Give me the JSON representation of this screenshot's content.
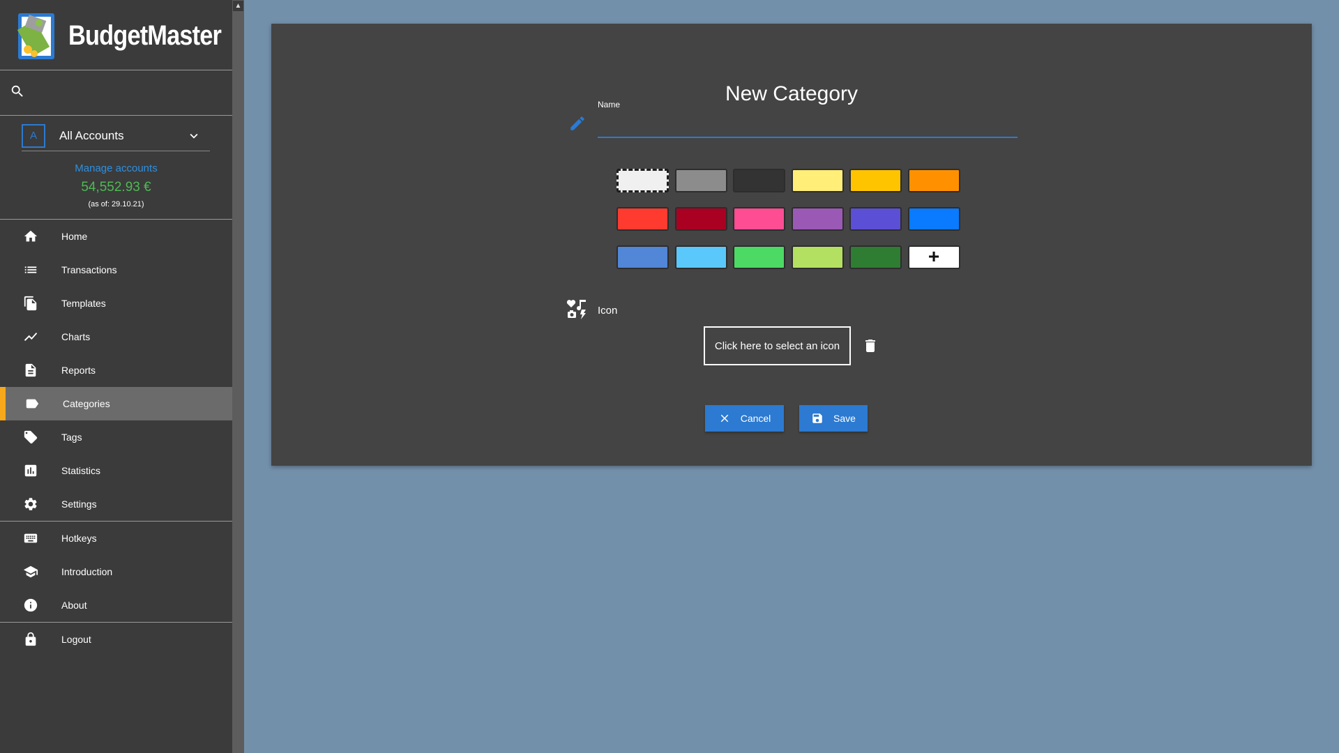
{
  "app": {
    "title": "BudgetMaster"
  },
  "account": {
    "avatar_letter": "A",
    "selected": "All Accounts",
    "manage_label": "Manage accounts",
    "balance": "54,552.93 €",
    "as_of": "(as of: 29.10.21)"
  },
  "nav": {
    "main": [
      {
        "label": "Home",
        "icon": "home-icon"
      },
      {
        "label": "Transactions",
        "icon": "list-icon"
      },
      {
        "label": "Templates",
        "icon": "copy-icon"
      },
      {
        "label": "Charts",
        "icon": "line-chart-icon"
      },
      {
        "label": "Reports",
        "icon": "document-icon"
      },
      {
        "label": "Categories",
        "icon": "label-icon",
        "active": true
      },
      {
        "label": "Tags",
        "icon": "tag-icon"
      },
      {
        "label": "Statistics",
        "icon": "bar-chart-icon"
      },
      {
        "label": "Settings",
        "icon": "gear-icon"
      }
    ],
    "secondary": [
      {
        "label": "Hotkeys",
        "icon": "keyboard-icon"
      },
      {
        "label": "Introduction",
        "icon": "graduation-cap-icon"
      },
      {
        "label": "About",
        "icon": "info-icon"
      }
    ],
    "logout": {
      "label": "Logout",
      "icon": "lock-icon"
    }
  },
  "form": {
    "title": "New Category",
    "name_label": "Name",
    "name_value": "",
    "icon_label": "Icon",
    "icon_select_label": "Click here to select an icon",
    "cancel_label": "Cancel",
    "save_label": "Save"
  },
  "colors": {
    "accent": "#2c7ad1",
    "active_marker": "#f7a81b",
    "balance": "#4dbb52",
    "swatches": [
      "#f0f0f0",
      "#8c8c8c",
      "#333333",
      "#ffee77",
      "#ffc400",
      "#ff9100",
      "#ff3b2f",
      "#aa0022",
      "#ff4d94",
      "#9b59b6",
      "#5b4fd6",
      "#0a7aff",
      "#5286d6",
      "#5ac8fa",
      "#4cd964",
      "#b4e061",
      "#2e7d32"
    ],
    "selected_swatch_index": 0
  }
}
